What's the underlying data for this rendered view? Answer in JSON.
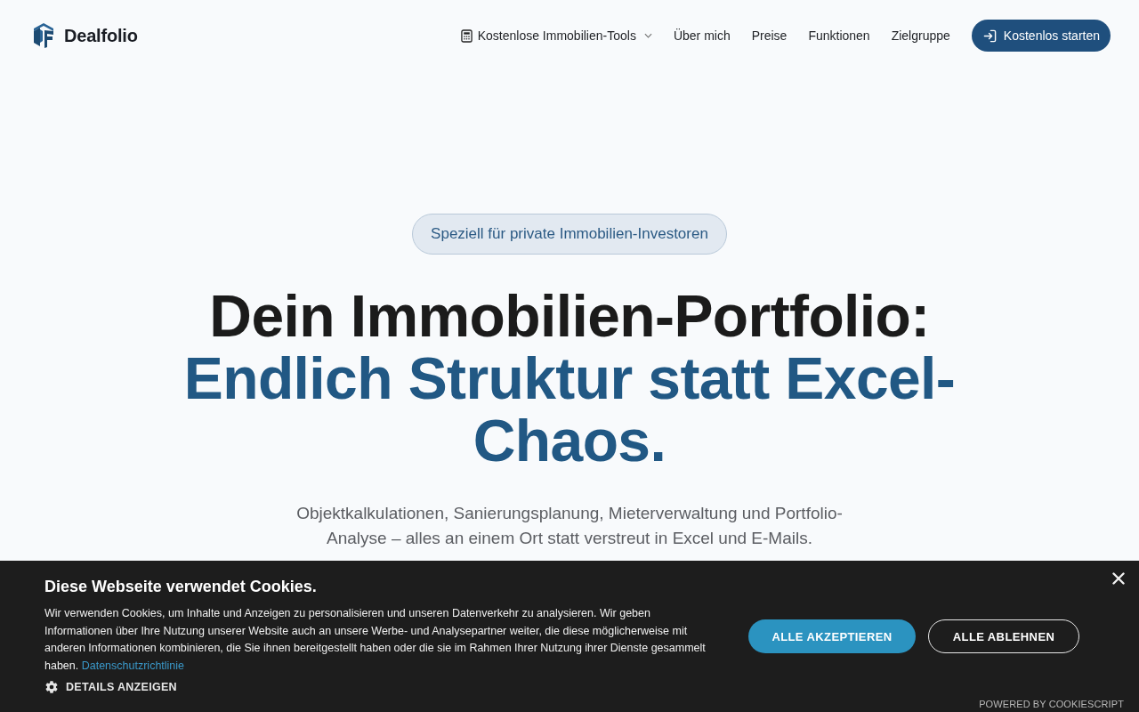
{
  "header": {
    "logo": "Dealfolio",
    "nav": [
      {
        "label": "Kostenlose Immobilien-Tools",
        "kind": "dropdown"
      },
      {
        "label": "Über mich",
        "kind": "link"
      },
      {
        "label": "Preise",
        "kind": "link"
      },
      {
        "label": "Funktionen",
        "kind": "link"
      },
      {
        "label": "Zielgruppe",
        "kind": "link"
      }
    ],
    "cta": "Kostenlos starten"
  },
  "hero": {
    "badge": "Speziell für private Immobilien-Investoren",
    "headline": "Dein Immobilien-Portfolio:",
    "headline_highlight": "Endlich Struktur statt Excel-Chaos.",
    "subtitle": "Objektkalkulationen, Sanierungsplanung, Mieterverwaltung und Portfolio-Analyse – alles an einem Ort statt verstreut in Excel und E-Mails."
  },
  "cookie_banner": {
    "title": "Diese Webseite verwendet Cookies.",
    "text": "Wir verwenden Cookies, um Inhalte und Anzeigen zu personalisieren und unseren Datenverkehr zu analysieren. Wir geben Informationen über Ihre Nutzung unserer Website auch an unsere Werbe- und Analysepartner weiter, die diese möglicherweise mit anderen Informationen kombinieren, die Sie ihnen bereitgestellt haben oder die sie im Rahmen Ihrer Nutzung ihrer Dienste gesammelt haben.",
    "policy_link": "Datenschutzrichtlinie",
    "details": "DETAILS ANZEIGEN",
    "buttons": [
      {
        "label": "ALLE AKZEPTIEREN",
        "kind": "primary"
      },
      {
        "label": "ALLE ABLEHNEN",
        "kind": "outline"
      }
    ],
    "powered_by": "POWERED BY COOKIESCRIPT"
  }
}
